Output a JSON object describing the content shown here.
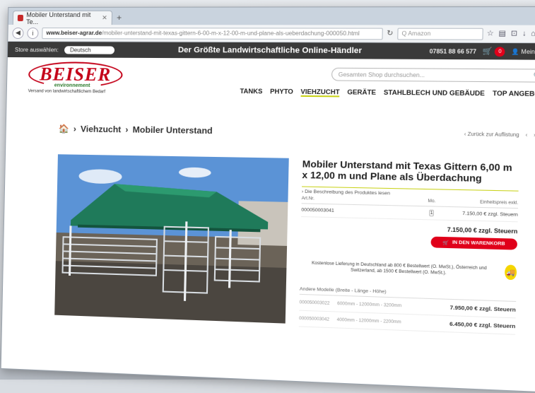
{
  "browser": {
    "tab_title": "Mobiler Unterstand mit Te...",
    "url_domain": "www.beiser-agrar.de",
    "url_path": "/mobiler-unterstand-mit-texas-gittern-6-00-m-x-12-00-m-und-plane-als-ueberdachung-000050.html",
    "search_placeholder": "Q Amazon"
  },
  "topbar": {
    "store_label": "Store auswählen:",
    "store_value": "Deutsch",
    "slogan": "Der Größte Landwirtschaftliche Online-Händler",
    "phone": "07851 88 66 577",
    "cart_count": "0",
    "account": "Mein Konto"
  },
  "header": {
    "logo_text": "BEISER",
    "logo_sub": "environnement",
    "tagline": "Versand von landwirtschaftlichem Bedarf",
    "search_placeholder": "Gesamten Shop durchsuchen...",
    "nav": [
      "TANKS",
      "PHYTO",
      "VIEHZUCHT",
      "GERÄTE",
      "STAHLBLECH UND GEBÄUDE",
      "TOP ANGEBOTE"
    ]
  },
  "breadcrumb": {
    "items": [
      "Viehzucht",
      "Mobiler Unterstand"
    ],
    "back_link": "Zurück zur Auflistung"
  },
  "product": {
    "title": "Mobiler Unterstand mit Texas Gittern 6,00 m x 12,00 m und Plane als Überdachung",
    "desc_link": "› Die Beschreibung des Produktes lesen",
    "col_art": "Art.Nr.",
    "col_qty": "Mo.",
    "col_price": "Einheitspreis exkl.",
    "sku": "000050003041",
    "qty": "1",
    "unit_price": "7.150,00 € zzgl. Steuern",
    "total_price": "7.150,00 € zzgl. Steuern",
    "cart_button": "IN DEN WARENKORB",
    "delivery_text": "Kostenlose Lieferung in Deutschland ab 800 € Bestellwert (O. MwSt.), Österreich und Switzerland, ab 1500 € Bestellwert (O. MwSt.).",
    "models_heading": "Andere Modelle (Breite - Länge - Höhe)",
    "models": [
      {
        "code": "000050003022",
        "dims": "6000mm - 12000mm - 3200mm",
        "price": "7.950,00 € zzgl. Steuern"
      },
      {
        "code": "000050003042",
        "dims": "4000mm - 12000mm - 2200mm",
        "price": "6.450,00 € zzgl. Steuern"
      }
    ]
  }
}
